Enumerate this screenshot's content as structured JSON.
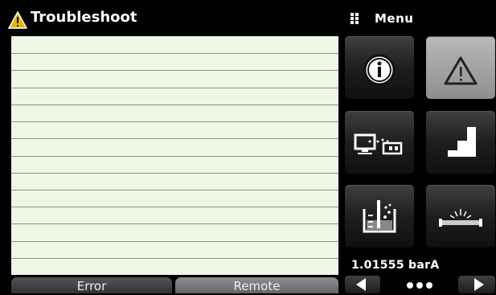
{
  "screen": {
    "title": "Troubleshoot",
    "title_icon": "warning-triangle-icon"
  },
  "log_panel": {
    "line_count": 14,
    "background": "#eef7e6"
  },
  "tabs": [
    {
      "label": "Error",
      "selected": true
    },
    {
      "label": "Remote",
      "selected": false
    }
  ],
  "menu": {
    "label": "Menu",
    "icon": "grid-dots-icon",
    "buttons": [
      {
        "icon": "info-icon",
        "active": false
      },
      {
        "icon": "warning-icon",
        "active": true
      },
      {
        "icon": "remote-computer-icon",
        "active": false
      },
      {
        "icon": "step-sequence-icon",
        "active": false
      },
      {
        "icon": "leak-test-icon",
        "active": false
      },
      {
        "icon": "burst-test-icon",
        "active": false
      }
    ]
  },
  "status": {
    "reading": "1.01555 barA"
  },
  "pagination": {
    "pages": 3,
    "current": 1
  },
  "colors": {
    "accent_warning": "#e8b400",
    "panel_bg": "#eef7e6",
    "background": "#000000"
  }
}
